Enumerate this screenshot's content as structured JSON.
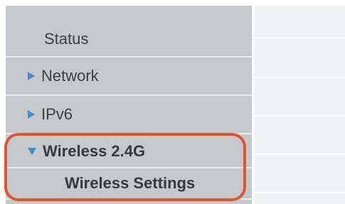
{
  "sidebar": {
    "items": [
      {
        "label": "Status",
        "expandable": false
      },
      {
        "label": "Network",
        "expandable": true,
        "state": "collapsed"
      },
      {
        "label": "IPv6",
        "expandable": true,
        "state": "collapsed"
      },
      {
        "label": "Wireless 2.4G",
        "expandable": true,
        "state": "expanded"
      }
    ],
    "subitems": [
      {
        "label": "Wireless Settings"
      }
    ]
  },
  "colors": {
    "sidebar_bg": "#c6c9cc",
    "arrow": "#3d8fd0",
    "highlight_outline": "#e0562c",
    "content_bg": "#eef0f1"
  },
  "icons": {
    "collapsed": "triangle-right-icon",
    "expanded": "triangle-down-icon"
  }
}
